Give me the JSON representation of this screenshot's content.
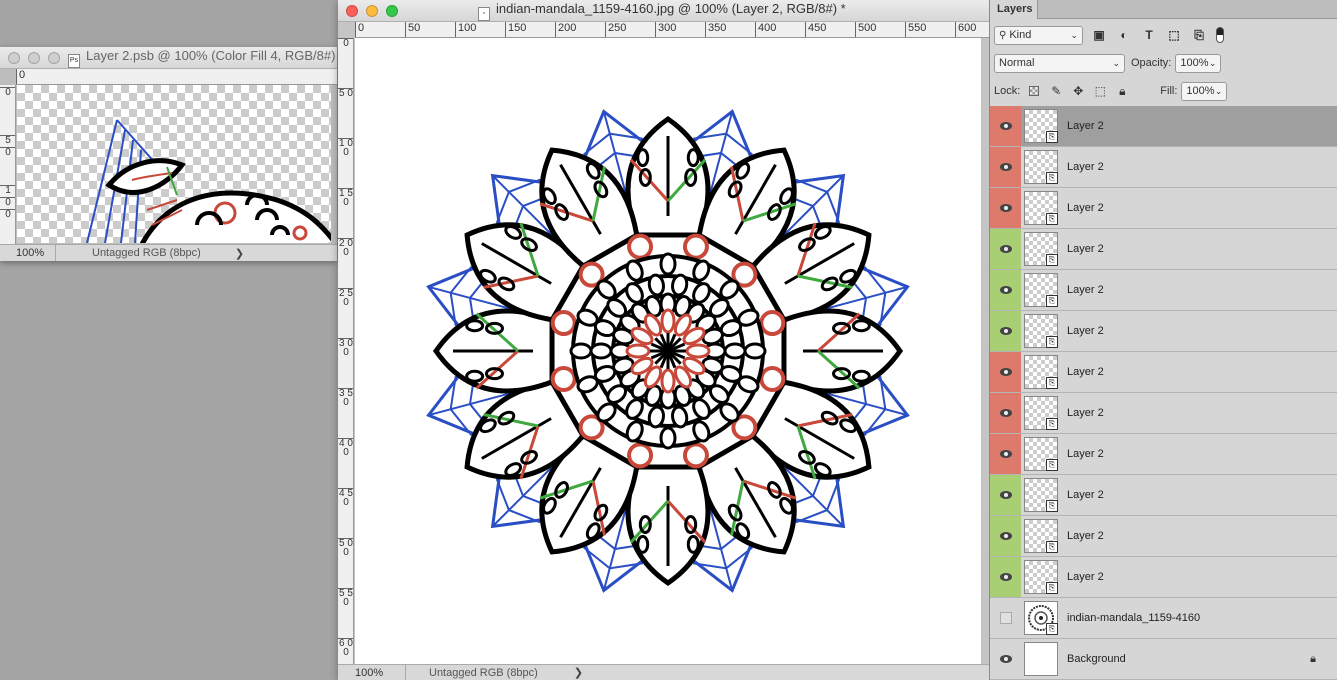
{
  "small_window": {
    "title": "Layer 2.psb @ 100% (Color Fill 4, RGB/8#)",
    "ruler_h": [
      "0"
    ],
    "ruler_v": [
      "0",
      "5",
      "0",
      "1",
      "0",
      "0"
    ],
    "status": {
      "zoom": "100%",
      "info": "Untagged RGB (8bpc)",
      "arrow": "❯"
    }
  },
  "main_window": {
    "title": "indian-mandala_1159-4160.jpg @ 100% (Layer 2, RGB/8#) *",
    "ruler_h": [
      "0",
      "50",
      "100",
      "150",
      "200",
      "250",
      "300",
      "350",
      "400",
      "450",
      "500",
      "550",
      "600"
    ],
    "ruler_v": [
      "0",
      "5 0",
      "1 0 0",
      "1 5 0",
      "2 0 0",
      "2 5 0",
      "3 0 0",
      "3 5 0",
      "4 0 0",
      "4 5 0",
      "5 0 0",
      "5 5 0",
      "6 0 0"
    ],
    "status": {
      "zoom": "100%",
      "info": "Untagged RGB (8bpc)",
      "arrow": "❯"
    }
  },
  "colors": {
    "red_visibility": "#dd7a6c",
    "green_visibility": "#a8cf74",
    "mandala_blue": "#2a4fc4",
    "mandala_red": "#c8483a",
    "mandala_green": "#3fa83f",
    "mandala_black": "#000000"
  },
  "layers_panel": {
    "tab": "Layers",
    "filter": {
      "label": "Kind",
      "icon": "search-icon"
    },
    "blend_mode": "Normal",
    "opacity_label": "Opacity:",
    "opacity_value": "100%",
    "lock_label": "Lock:",
    "fill_label": "Fill:",
    "fill_value": "100%",
    "layers": [
      {
        "name": "Layer 2",
        "color": "red",
        "visible": true,
        "active": true,
        "thumb": "checker",
        "smart": true
      },
      {
        "name": "Layer 2",
        "color": "red",
        "visible": true,
        "thumb": "checker",
        "smart": true
      },
      {
        "name": "Layer 2",
        "color": "red",
        "visible": true,
        "thumb": "checker",
        "smart": true
      },
      {
        "name": "Layer 2",
        "color": "green",
        "visible": true,
        "thumb": "checker",
        "smart": true
      },
      {
        "name": "Layer 2",
        "color": "green",
        "visible": true,
        "thumb": "checker",
        "smart": true
      },
      {
        "name": "Layer 2",
        "color": "green",
        "visible": true,
        "thumb": "checker",
        "smart": true
      },
      {
        "name": "Layer 2",
        "color": "red",
        "visible": true,
        "thumb": "checker",
        "smart": true
      },
      {
        "name": "Layer 2",
        "color": "red",
        "visible": true,
        "thumb": "checker",
        "smart": true
      },
      {
        "name": "Layer 2",
        "color": "red",
        "visible": true,
        "thumb": "checker",
        "smart": true
      },
      {
        "name": "Layer 2",
        "color": "green",
        "visible": true,
        "thumb": "checker",
        "smart": true
      },
      {
        "name": "Layer 2",
        "color": "green",
        "visible": true,
        "thumb": "checker",
        "smart": true
      },
      {
        "name": "Layer 2",
        "color": "green",
        "visible": true,
        "thumb": "checker",
        "smart": true
      },
      {
        "name": "indian-mandala_1159-4160",
        "color": "none",
        "visible": false,
        "thumb": "mandala",
        "smart": true
      },
      {
        "name": "Background",
        "color": "none",
        "visible": true,
        "thumb": "white",
        "smart": false,
        "locked": true
      }
    ]
  }
}
